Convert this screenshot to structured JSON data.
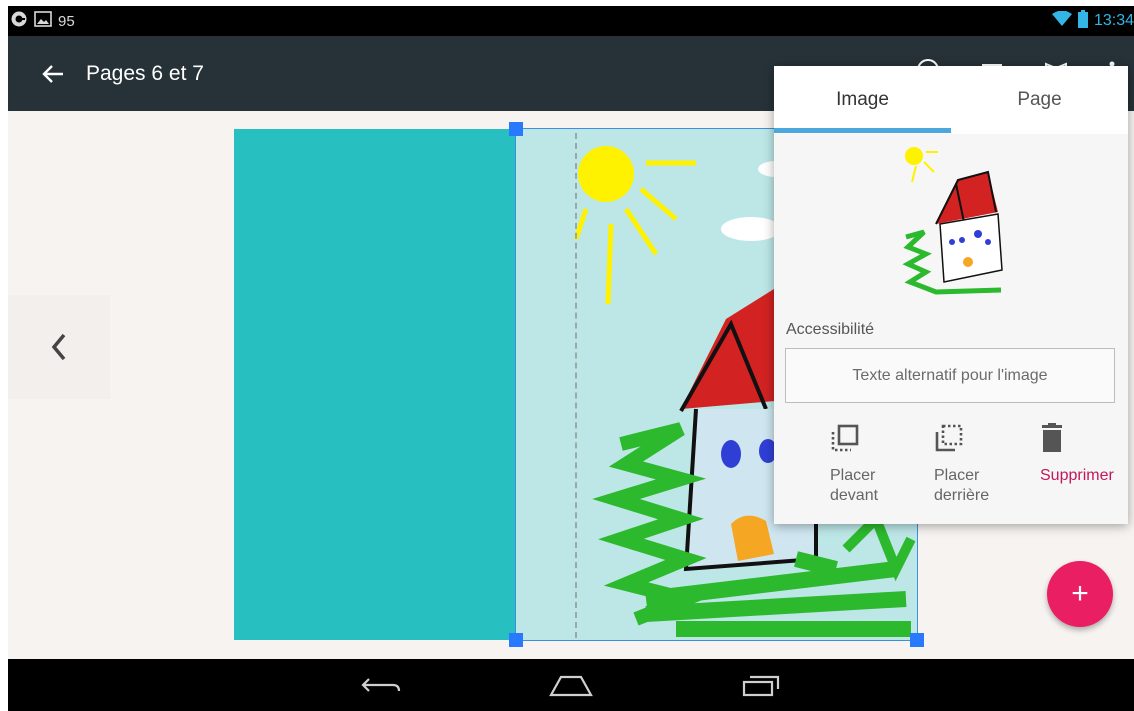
{
  "status_bar": {
    "notification_count": "95",
    "time": "13:34"
  },
  "app_bar": {
    "title": "Pages 6 et 7"
  },
  "panel": {
    "tabs": [
      {
        "label": "Image",
        "active": true
      },
      {
        "label": "Page",
        "active": false
      }
    ],
    "accessibility_label": "Accessibilité",
    "alt_text": {
      "value": "",
      "placeholder": "Texte alternatif pour l'image"
    },
    "actions": [
      {
        "label": "Placer devant",
        "icon": "bring-to-front-icon"
      },
      {
        "label": "Placer derrière",
        "icon": "send-to-back-icon"
      },
      {
        "label": "Supprimer",
        "icon": "trash-icon"
      }
    ]
  },
  "fab": {
    "label": "+"
  },
  "colors": {
    "app_bar": "#263238",
    "page_left": "#27bfbf",
    "page_right": "#bde7e7",
    "tab_indicator": "#4aa8dc",
    "fab": "#e91e63",
    "danger": "#c2185b",
    "selection": "#2979ff"
  }
}
